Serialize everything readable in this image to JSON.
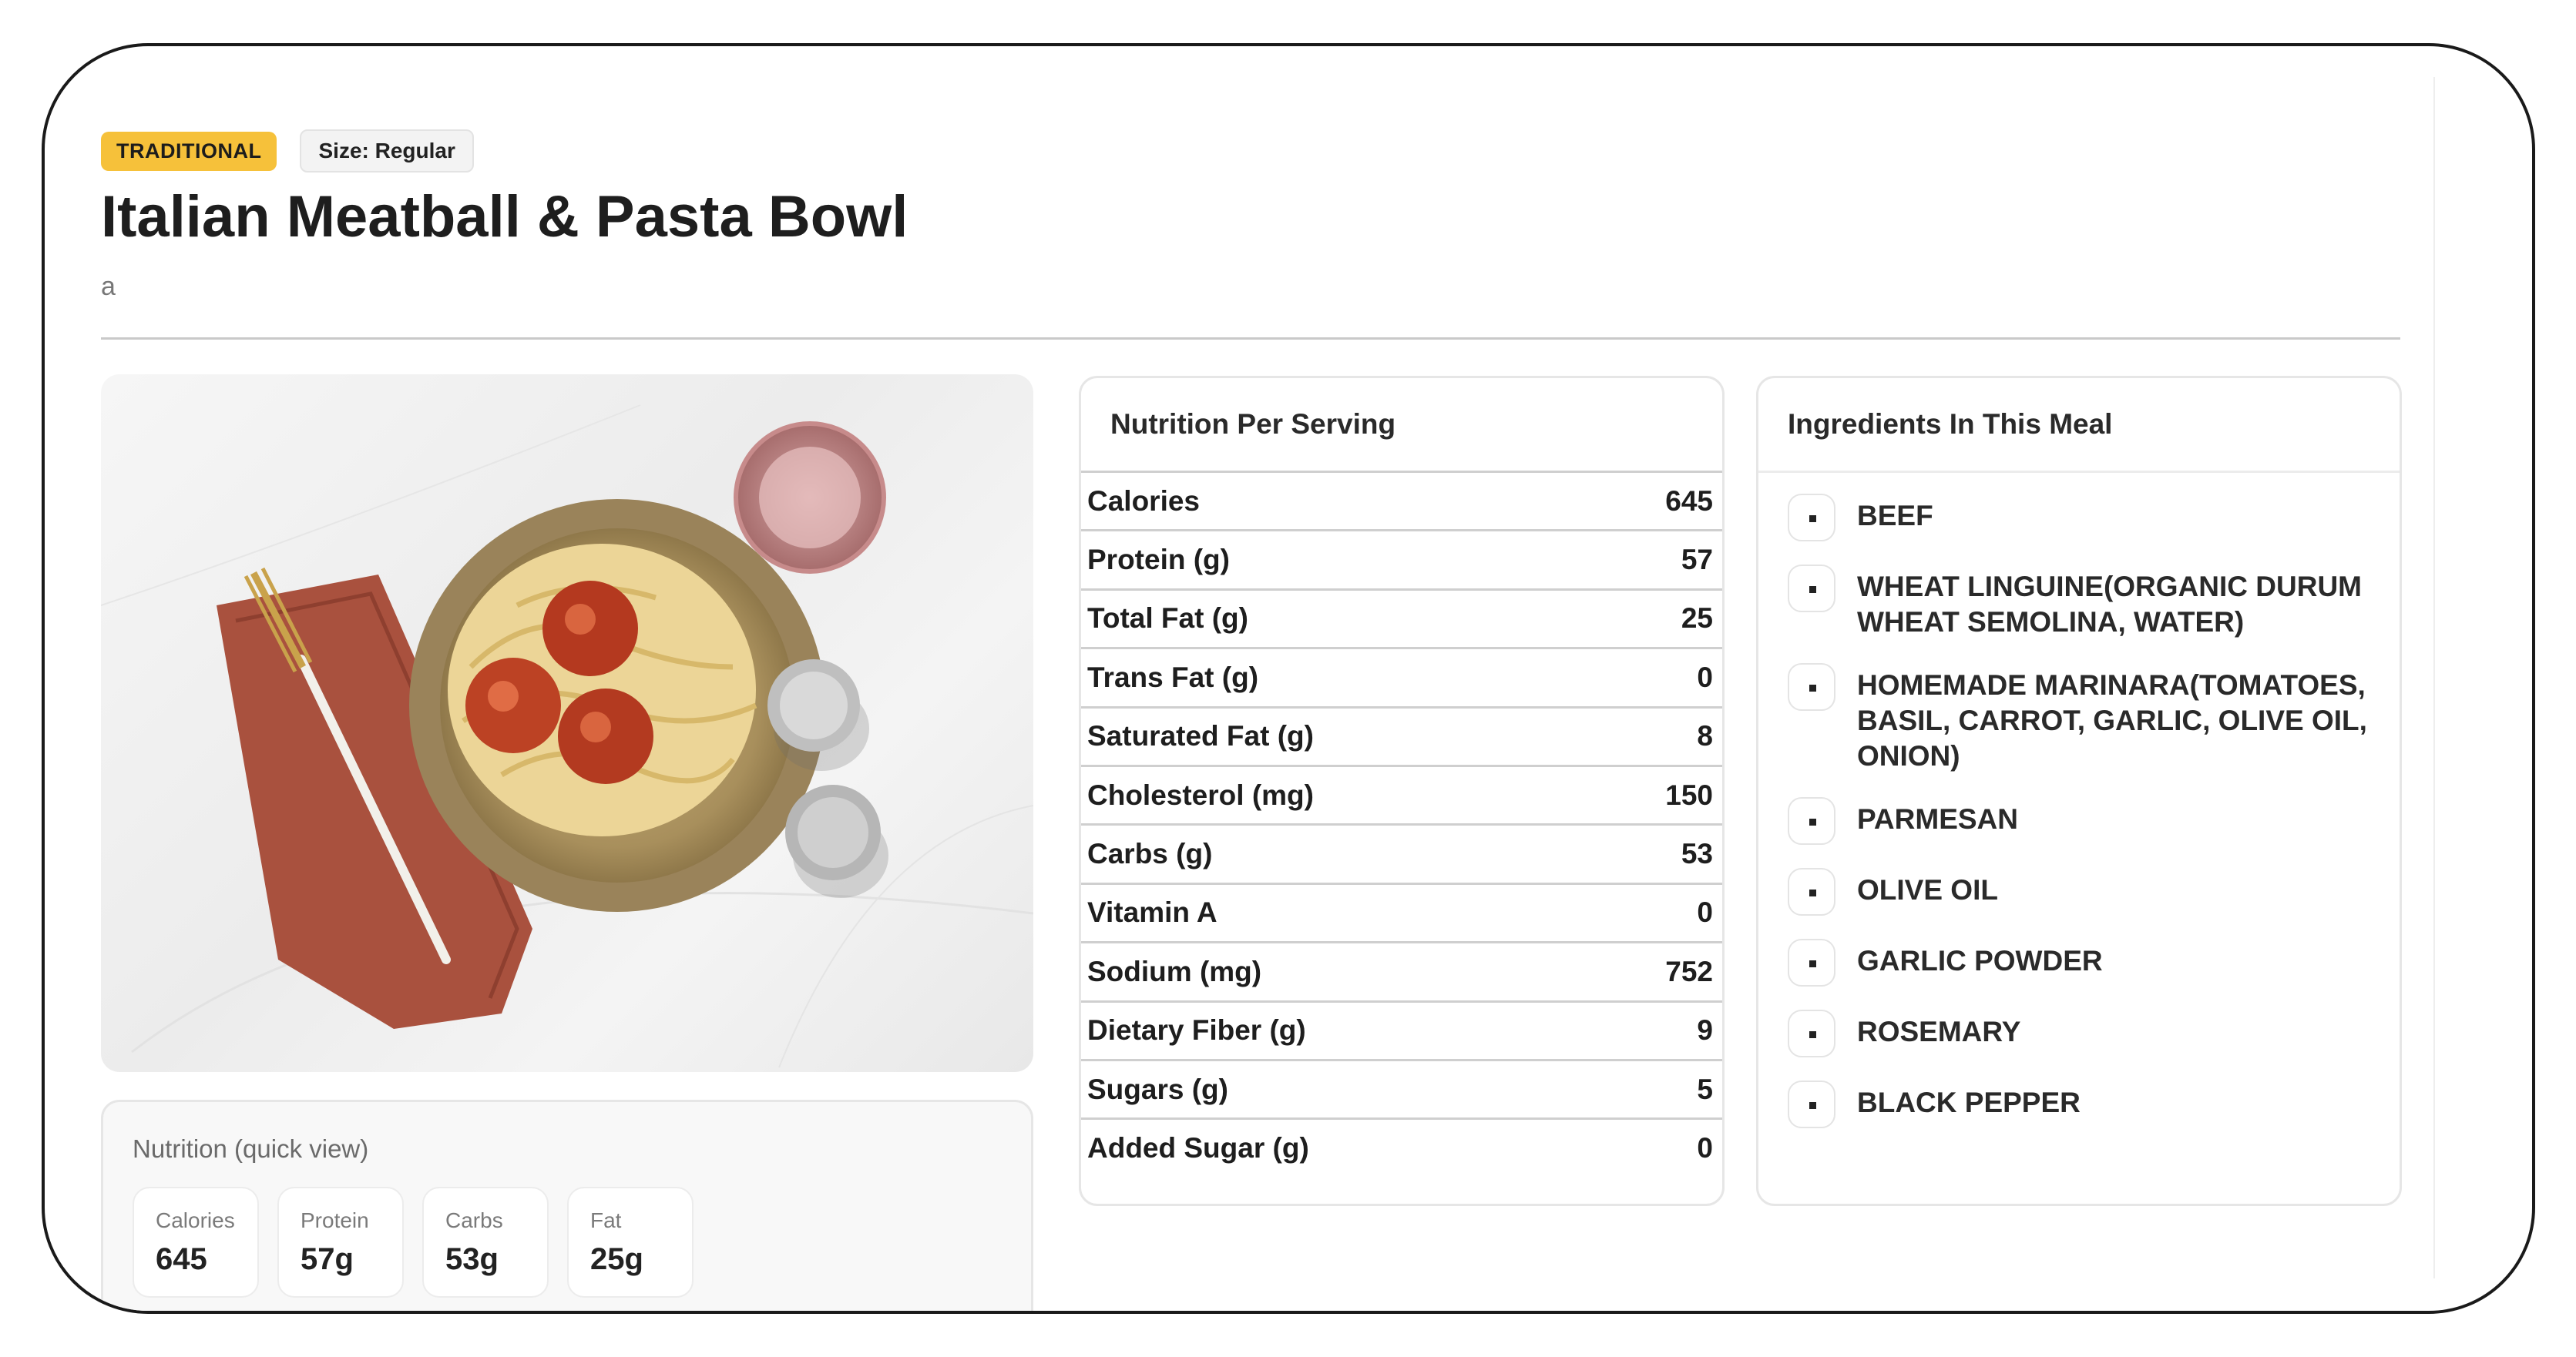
{
  "meal": {
    "badge_type": "TRADITIONAL",
    "badge_size": "Size: Regular",
    "title": "Italian Meatball & Pasta Bowl",
    "subtitle": "a",
    "image_alt": "Italian Meatball & Pasta Bowl photo"
  },
  "quick_view": {
    "title": "Nutrition (quick view)",
    "cards": [
      {
        "label": "Calories",
        "value": "645"
      },
      {
        "label": "Protein",
        "value": "57g"
      },
      {
        "label": "Carbs",
        "value": "53g"
      },
      {
        "label": "Fat",
        "value": "25g"
      }
    ]
  },
  "nutrition": {
    "title": "Nutrition Per Serving",
    "rows": [
      {
        "label": "Calories",
        "value": "645"
      },
      {
        "label": "Protein (g)",
        "value": "57"
      },
      {
        "label": "Total Fat (g)",
        "value": "25"
      },
      {
        "label": "Trans Fat (g)",
        "value": "0"
      },
      {
        "label": "Saturated Fat (g)",
        "value": "8"
      },
      {
        "label": "Cholesterol (mg)",
        "value": "150"
      },
      {
        "label": "Carbs (g)",
        "value": "53"
      },
      {
        "label": "Vitamin A",
        "value": "0"
      },
      {
        "label": "Sodium (mg)",
        "value": "752"
      },
      {
        "label": "Dietary Fiber (g)",
        "value": "9"
      },
      {
        "label": "Sugars (g)",
        "value": "5"
      },
      {
        "label": "Added Sugar (g)",
        "value": "0"
      }
    ]
  },
  "ingredients": {
    "title": "Ingredients In This Meal",
    "items": [
      "BEEF",
      "WHEAT LINGUINE(ORGANIC DURUM WHEAT SEMOLINA, WATER)",
      "HOMEMADE MARINARA(TOMATOES, BASIL, CARROT, GARLIC, OLIVE OIL, ONION)",
      "PARMESAN",
      "OLIVE OIL",
      "GARLIC POWDER",
      "ROSEMARY",
      "BLACK PEPPER"
    ]
  },
  "colors": {
    "badge_traditional": "#f6c13a",
    "frame_border": "#1a1a1a"
  }
}
